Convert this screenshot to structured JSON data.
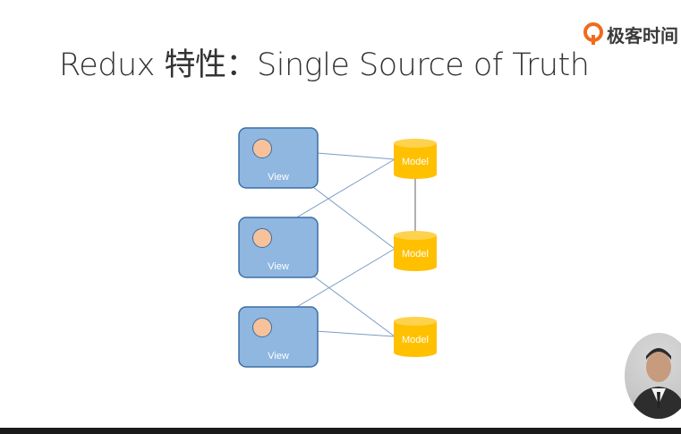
{
  "slide": {
    "title": "Redux 特性：Single Source of Truth",
    "brand": {
      "text": "极客时间",
      "logo_icon": "geektime-logo-icon",
      "logo_color": "#f26a1b"
    },
    "diagram": {
      "views": [
        {
          "label": "View"
        },
        {
          "label": "View"
        },
        {
          "label": "View"
        }
      ],
      "models": [
        {
          "label": "Model"
        },
        {
          "label": "Model"
        },
        {
          "label": "Model"
        }
      ],
      "colors": {
        "view_fill": "#8fb7e0",
        "view_stroke": "#3b6ea5",
        "circle_fill": "#f7c29a",
        "model_fill": "#ffc000",
        "model_top": "#ffd24d",
        "connector": "#7a9cc6"
      }
    },
    "presenter_video": {
      "icon": "presenter-webcam"
    }
  }
}
